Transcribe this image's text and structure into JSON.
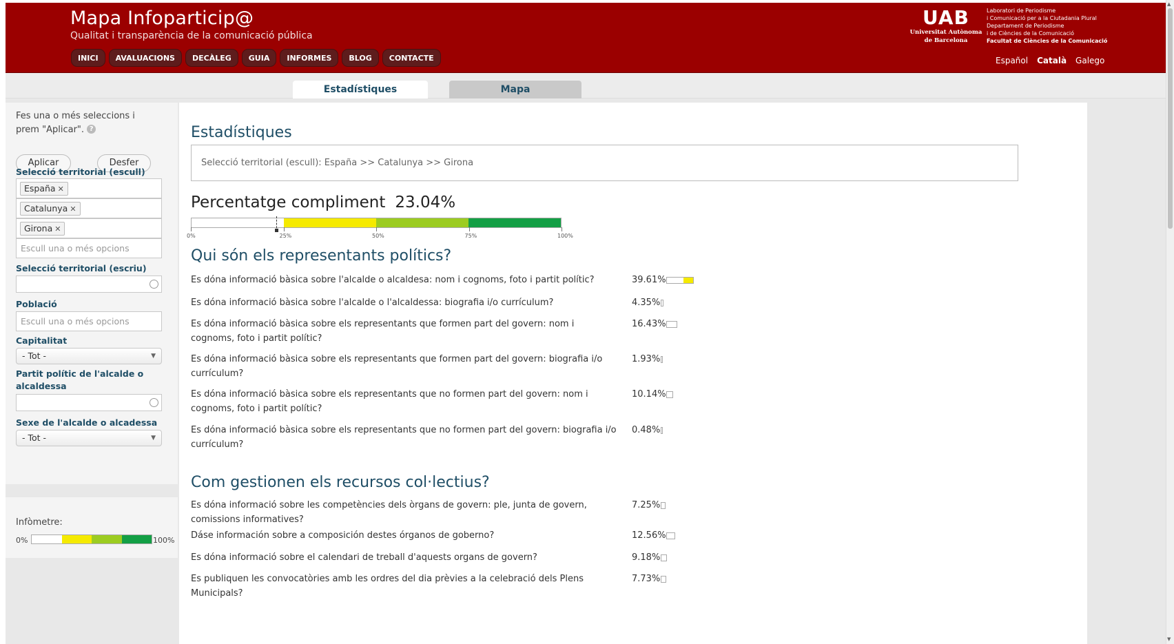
{
  "colors": {
    "header_bg": "#9b0000",
    "title_blue": "#1f4e66",
    "scale": [
      "#ffffff",
      "#f5ea00",
      "#9ccc21",
      "#2fae3e",
      "#139f45"
    ]
  },
  "header": {
    "title": "Mapa Infoparticip@",
    "subtitle": "Qualitat i transparència de la comunicació pública",
    "nav": [
      "INICI",
      "AVALUACIONS",
      "DECÀLEG",
      "GUIA",
      "INFORMES",
      "BLOG",
      "CONTACTE"
    ],
    "uab_mark": "UAB",
    "uab_name_line1": "Universitat Autònoma",
    "uab_name_line2": "de Barcelona",
    "lab_lines": [
      "Laboratori de Periodisme",
      "i Comunicació per a la Ciutadania Plural",
      "Departament de Periodisme",
      "i de Ciències de la Comunicació",
      "Facultat de Ciències de la Comunicació"
    ],
    "languages": [
      "Español",
      "Català",
      "Galego"
    ],
    "active_language": "Català"
  },
  "tabs": [
    "Estadístiques",
    "Mapa"
  ],
  "sidebar": {
    "hint": "Fes una o més seleccions i prem \"Aplicar\".",
    "help_icon": "?",
    "apply_label": "Aplicar",
    "undo_label": "Desfer",
    "territorial_choose_label": "Selecció territorial (escull)",
    "chips": [
      "España",
      "Catalunya",
      "Girona"
    ],
    "chip_remove": "✕",
    "choose_placeholder": "Escull una o més opcions",
    "territorial_write_label": "Selecció territorial (escriu)",
    "population_label": "Població",
    "population_placeholder": "Escull una o més opcions",
    "capital_label": "Capitalitat",
    "capital_value": "- Tot -",
    "party_label": "Partit polític de l'alcalde o alcaldessa",
    "sex_label": "Sexe de l'alcalde o alcadessa",
    "sex_value": "- Tot -"
  },
  "legend": {
    "label": "Infòmetre:",
    "min": "0%",
    "max": "100%"
  },
  "main": {
    "title": "Estadístiques",
    "selection_text": "Selecció territorial (escull): España >> Catalunya >> Girona",
    "compliance_label": "Percentatge compliment",
    "compliance_value": "23.04%",
    "compliance_fraction": 0.2304,
    "ticks": [
      "0%",
      "25%",
      "50%",
      "75%",
      "100%"
    ]
  },
  "sections": [
    {
      "title": "Qui són els representants polítics?",
      "questions": [
        {
          "text": "Es dóna informació bàsica sobre l'alcalde o alcaldesa: nom i cognoms, foto i partit polític?",
          "value": "39.61%",
          "fraction": 0.3961
        },
        {
          "text": "Es dóna informació bàsica sobre l'alcalde o l'alcaldessa: biografia i/o currículum?",
          "value": "4.35%",
          "fraction": 0.0435
        },
        {
          "text": "Es dóna informació bàsica sobre els representants que formen part del govern: nom i cognoms, foto i partit polític?",
          "value": "16.43%",
          "fraction": 0.1643
        },
        {
          "text": "Es dóna informació bàsica sobre els representants que formen part del govern: biografia i/o currículum?",
          "value": "1.93%",
          "fraction": 0.0193
        },
        {
          "text": "Es dóna informació bàsica sobre els representants que no formen part del govern: nom i cognoms, foto i partit polític?",
          "value": "10.14%",
          "fraction": 0.1014
        },
        {
          "text": "Es dóna informació bàsica sobre els representants que no formen part del govern: biografia i/o currículum?",
          "value": "0.48%",
          "fraction": 0.0048
        }
      ]
    },
    {
      "title": "Com gestionen els recursos col·lectius?",
      "questions": [
        {
          "text": "Es dóna informació sobre les competències dels òrgans de govern: ple, junta de govern, comissions informatives?",
          "value": "7.25%",
          "fraction": 0.0725
        },
        {
          "text": "Dáse información sobre a composición destes órganos de goberno?",
          "value": "12.56%",
          "fraction": 0.1256
        },
        {
          "text": "Es dóna informació sobre el calendari de treball d'aquests organs de govern?",
          "value": "9.18%",
          "fraction": 0.0918
        },
        {
          "text": "Es publiquen les convocatòries amb les ordres del dia prèvies a la celebració dels Plens Municipals?",
          "value": "7.73%",
          "fraction": 0.0773
        }
      ]
    }
  ]
}
